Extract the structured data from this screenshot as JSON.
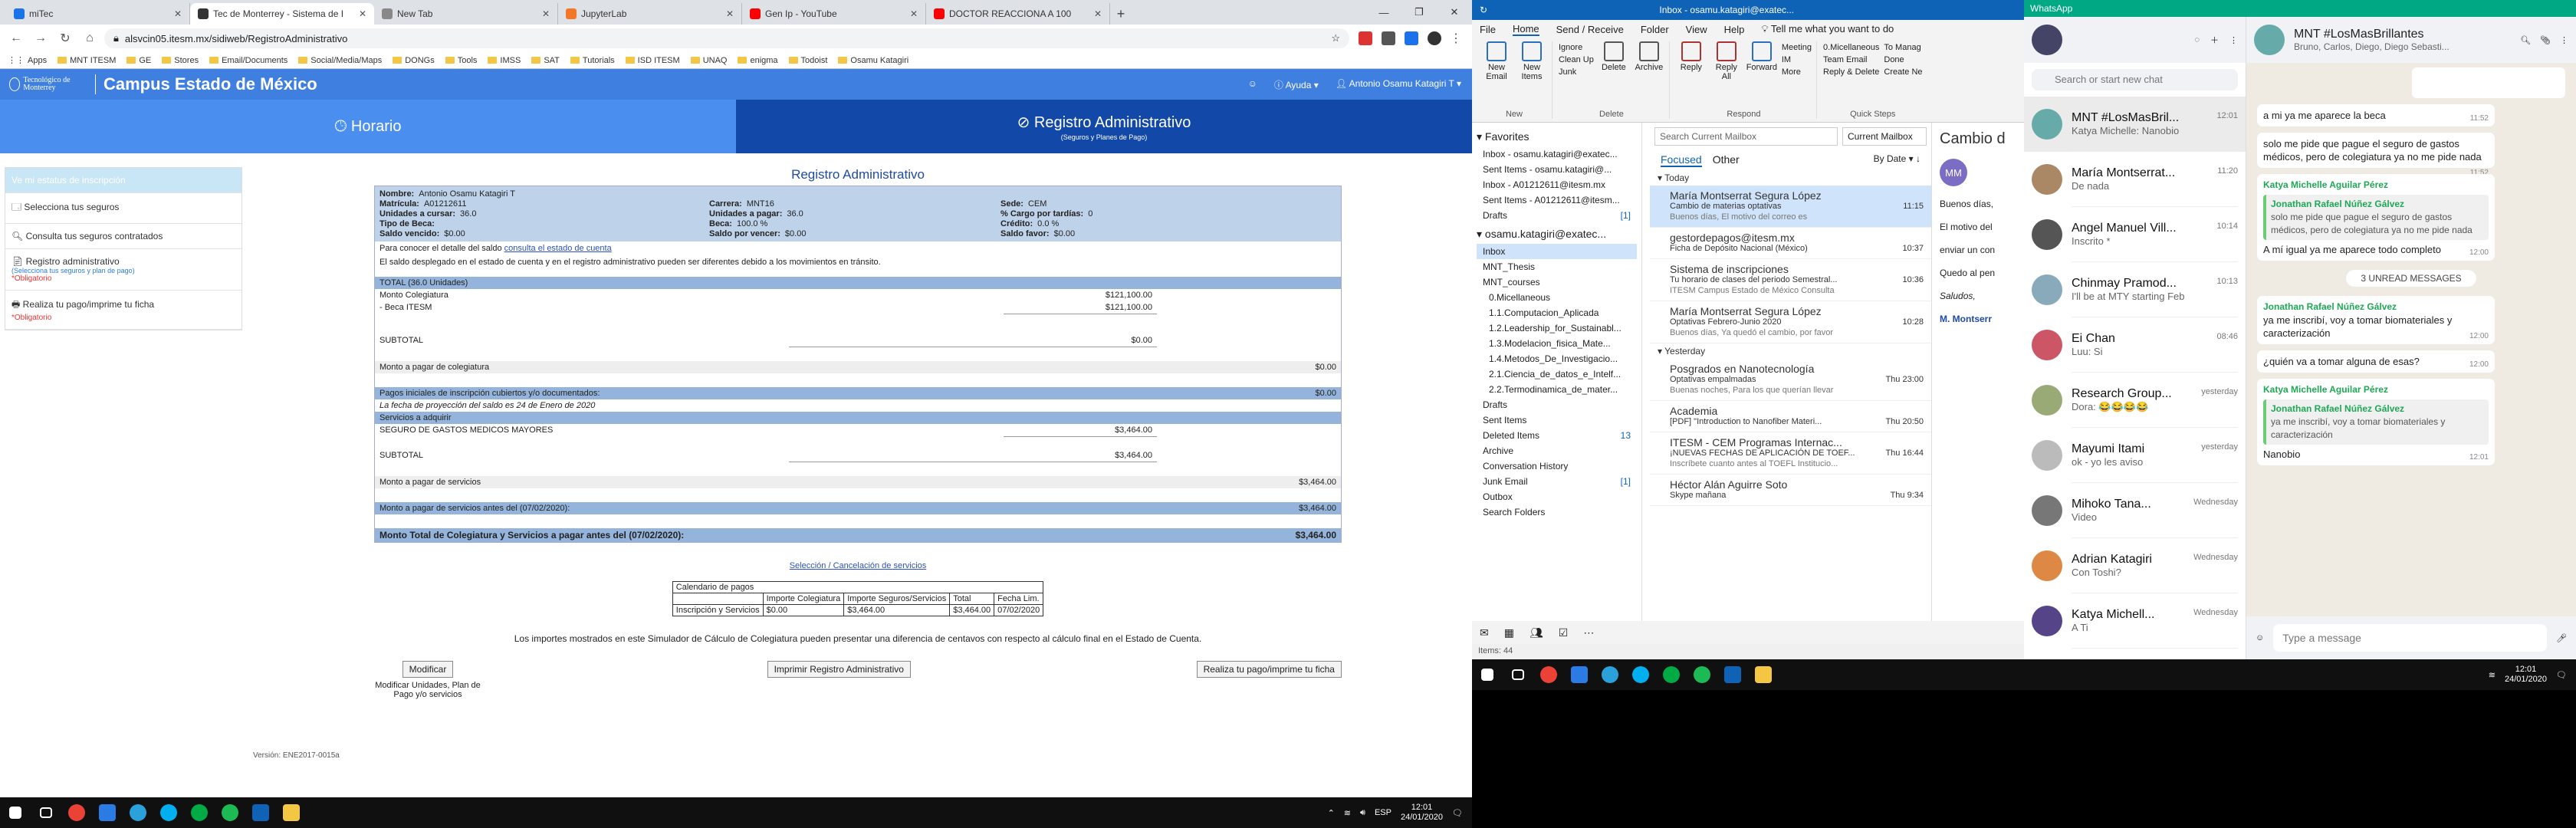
{
  "chrome": {
    "tabs": [
      {
        "title": "miTec",
        "color": "#1a73e8",
        "active": false
      },
      {
        "title": "Tec de Monterrey - Sistema de I",
        "color": "#333",
        "active": true
      },
      {
        "title": "New Tab",
        "color": "#888",
        "active": false
      },
      {
        "title": "JupyterLab",
        "color": "#f37726",
        "active": false
      },
      {
        "title": "Gen Ip - YouTube",
        "color": "#ff0000",
        "active": false
      },
      {
        "title": "DOCTOR REACCIONA A 100",
        "color": "#ff0000",
        "active": false
      }
    ],
    "url": "alsvcin05.itesm.mx/sidiweb/RegistroAdministrativo",
    "bookmarks": [
      "Apps",
      "MNT ITESM",
      "GE",
      "Stores",
      "Email/Documents",
      "Social/Media/Maps",
      "DONGs",
      "Tools",
      "IMSS",
      "SAT",
      "Tutorials",
      "ISD ITESM",
      "UNAQ",
      "enigma",
      "Todoist",
      "Osamu Katagiri"
    ]
  },
  "site": {
    "logo": "Tecnológico de Monterrey",
    "campus": "Campus Estado de México",
    "help": "Ayuda",
    "user": "Antonio Osamu Katagiri T",
    "tab_horario": "Horario",
    "tab_registro": "Registro Administrativo",
    "tab_registro_sub": "(Seguros y Planes de Pago)",
    "menu": [
      {
        "label": "Ve mi estatus de inscripción",
        "sub": "",
        "req": ""
      },
      {
        "label": "Selecciona tus seguros",
        "sub": "",
        "req": ""
      },
      {
        "label": "Consulta tus seguros contratados",
        "sub": "",
        "req": ""
      },
      {
        "label": "Registro administrativo",
        "sub": "(Selecciona tus seguros y plan de pago)",
        "req": "*Obligatorio"
      },
      {
        "label": "Realiza tu pago/imprime tu ficha",
        "sub": "",
        "req": "*Obligatorio"
      }
    ],
    "title": "Registro Administrativo",
    "info": [
      [
        "Nombre:",
        "Antonio Osamu Katagiri T"
      ],
      [
        "",
        ""
      ],
      [
        "",
        ""
      ],
      [
        "Matrícula:",
        "A01212611"
      ],
      [
        "Carrera:",
        "MNT16"
      ],
      [
        "Sede:",
        "CEM"
      ],
      [
        "Unidades a cursar:",
        "36.0"
      ],
      [
        "Unidades a pagar:",
        "36.0"
      ],
      [
        "% Cargo por tardías:",
        "0"
      ],
      [
        "Tipo de Beca:",
        ""
      ],
      [
        "Beca:",
        "100.0 %"
      ],
      [
        "Crédito:",
        "0.0 %"
      ],
      [
        "Saldo vencido:",
        "$0.00"
      ],
      [
        "Saldo por vencer:",
        "$0.00"
      ],
      [
        "Saldo favor:",
        "$0.00"
      ]
    ],
    "note1": "Para conocer el detalle del saldo",
    "note1_link": "consulta el estado de cuenta",
    "note2": "El saldo desplegado en el estado de cuenta y en el registro administrativo pueden ser diferentes debido a los movimientos en tránsito.",
    "total_header": "TOTAL (36.0 Unidades)",
    "colegiatura": "Monto Colegiatura",
    "colegiatura_amt": "$121,100.00",
    "beca": "- Beca ITESM",
    "beca_amt": "$121,100.00",
    "subtotal": "SUBTOTAL",
    "subtotal1_amt": "$0.00",
    "pagar_coleg": "Monto a pagar de colegiatura",
    "pagar_coleg_amt": "$0.00",
    "pagos_iniciales": "Pagos iniciales de inscripción cubiertos y/o documentados:",
    "pagos_iniciales_amt": "$0.00",
    "fecha_proy": "La fecha de proyección del saldo es 24 de Enero de 2020",
    "servicios": "Servicios a adquirir",
    "seguro": "SEGURO DE GASTOS MEDICOS MAYORES",
    "seguro_amt": "$3,464.00",
    "subtotal2_amt": "$3,464.00",
    "pagar_serv": "Monto a pagar de servicios",
    "pagar_serv_amt": "$3,464.00",
    "pagar_serv_antes": "Monto a pagar de servicios antes del (07/02/2020):",
    "pagar_serv_antes_amt": "$3,464.00",
    "total_antes": "Monto Total de Colegiatura y Servicios a pagar antes del (07/02/2020):",
    "total_antes_amt": "$3,464.00",
    "seleccion_link": "Selección / Cancelación de servicios",
    "cal_title": "Calendario de pagos",
    "cal_headers": [
      "",
      "Importe Colegiatura",
      "Importe Seguros/Servicios",
      "Total",
      "Fecha Lim."
    ],
    "cal_row": [
      "Inscripción y Servicios",
      "$0.00",
      "$3,464.00",
      "$3,464.00",
      "07/02/2020"
    ],
    "disclaimer": "Los importes mostrados en este Simulador de Cálculo de Colegiatura pueden presentar una diferencia de centavos con respecto al cálculo final en el Estado de Cuenta.",
    "btn_modificar": "Modificar",
    "btn_modificar_sub": "Modificar Unidades, Plan de Pago y/o servicios",
    "btn_imprimir": "Imprimir Registro Administrativo",
    "btn_pago": "Realiza tu pago/imprime tu ficha",
    "version": "Versión: ENE2017-0015a"
  },
  "taskbar_left": {
    "lang": "ESP",
    "time": "12:01",
    "date": "24/01/2020"
  },
  "outlook": {
    "title": "Inbox - osamu.katagiri@exatec...",
    "menu": [
      "File",
      "Home",
      "Send / Receive",
      "Folder",
      "View",
      "Help",
      "Tell me what you want to do"
    ],
    "ribbon": {
      "new_email": "New Email",
      "new_items": "New Items",
      "new": "New",
      "ignore": "Ignore",
      "clean": "Clean Up",
      "junk": "Junk",
      "delete": "Delete",
      "archive": "Archive",
      "delete_group": "Delete",
      "reply": "Reply",
      "reply_all": "Reply All",
      "forward": "Forward",
      "meeting": "Meeting",
      "im": "IM",
      "more": "More",
      "respond": "Respond",
      "qs1": "0.Micellaneous",
      "qs2": "Team Email",
      "qs3": "Reply & Delete",
      "qs4": "To Manag",
      "qs5": "Done",
      "qs6": "Create Ne",
      "quick": "Quick Steps"
    },
    "favorites": "Favorites",
    "fav": [
      {
        "n": "Inbox - osamu.katagiri@exatec...",
        "c": ""
      },
      {
        "n": "Sent Items - osamu.katagiri@...",
        "c": ""
      },
      {
        "n": "Inbox - A01212611@itesm.mx",
        "c": ""
      },
      {
        "n": "Sent Items - A01212611@itesm...",
        "c": ""
      },
      {
        "n": "Drafts",
        "c": "[1]"
      }
    ],
    "account": "osamu.katagiri@exatec...",
    "folders": [
      {
        "n": "Inbox",
        "c": "",
        "sel": true
      },
      {
        "n": "MNT_Thesis",
        "c": ""
      },
      {
        "n": "MNT_courses",
        "c": ""
      },
      {
        "n": "0.Micellaneous",
        "c": ""
      },
      {
        "n": "1.1.Computacion_Aplicada",
        "c": ""
      },
      {
        "n": "1.2.Leadership_for_Sustainabl...",
        "c": ""
      },
      {
        "n": "1.3.Modelacion_fisica_Mate...",
        "c": ""
      },
      {
        "n": "1.4.Metodos_De_Investigacio...",
        "c": ""
      },
      {
        "n": "2.1.Ciencia_de_datos_e_Intelf...",
        "c": ""
      },
      {
        "n": "2.2.Termodinamica_de_mater...",
        "c": ""
      },
      {
        "n": "Drafts",
        "c": ""
      },
      {
        "n": "Sent Items",
        "c": ""
      },
      {
        "n": "Deleted Items",
        "c": "13"
      },
      {
        "n": "Archive",
        "c": ""
      },
      {
        "n": "Conversation History",
        "c": ""
      },
      {
        "n": "Junk Email",
        "c": "[1]"
      },
      {
        "n": "Outbox",
        "c": ""
      },
      {
        "n": "Search Folders",
        "c": ""
      }
    ],
    "search": "Search Current Mailbox",
    "scope": "Current Mailbox",
    "focused": "Focused",
    "other": "Other",
    "bydate": "By Date",
    "today": "Today",
    "yesterday": "Yesterday",
    "mails_today": [
      {
        "from": "María Montserrat Segura López",
        "subj": "Cambio de materias optativas",
        "time": "11:15",
        "prev": "Buenos días,  El motivo del correo es",
        "sel": true
      },
      {
        "from": "gestordepagos@itesm.mx",
        "subj": "Ficha de Depósito Nacional (México)",
        "time": "10:37",
        "prev": "",
        "sel": false
      },
      {
        "from": "Sistema de inscripciones",
        "subj": "Tu horario de clases del periodo Semestral...",
        "time": "10:36",
        "prev": "ITESM Campus Estado de México  Consulta",
        "sel": false
      },
      {
        "from": "María Montserrat Segura López",
        "subj": "Optativas Febrero-Junio 2020",
        "time": "10:28",
        "prev": "Buenos días,  Ya quedó el cambio, por favor",
        "sel": false
      }
    ],
    "mails_yesterday": [
      {
        "from": "Posgrados en Nanotecnología",
        "subj": "Optativas empalmadas",
        "time": "Thu 23:00",
        "prev": "Buenas noches,  Para los que querían llevar"
      },
      {
        "from": "Academia",
        "subj": "[PDF] \"Introduction to Nanofiber Materi...",
        "time": "Thu 20:50",
        "prev": ""
      },
      {
        "from": "ITESM - CEM Programas Internac...",
        "subj": "¡NUEVAS FECHAS DE APLICACIÓN DE TOEF...",
        "time": "Thu 16:44",
        "prev": "Inscríbete cuanto antes al TOEFL Institucio..."
      },
      {
        "from": "Héctor Alán Aguirre Soto",
        "subj": "Skype mañana",
        "time": "Thu 9:34",
        "prev": ""
      }
    ],
    "reading_title": "Cambio d",
    "reading_greet": "Buenos días,",
    "reading_l1": "El motivo del",
    "reading_l2": "enviar un con",
    "reading_l3": "Quedo al pen",
    "reading_sal": "Saludos,",
    "reading_sig": "M. Montserr",
    "items": "Items: 44"
  },
  "whatsapp": {
    "title": "WhatsApp",
    "search": "Search or start new chat",
    "chats": [
      {
        "n": "MNT #LosMasBril...",
        "m": "Katya Michelle: Nanobio",
        "t": "12:01",
        "c": "#6aa",
        "sel": true
      },
      {
        "n": "María Montserrat...",
        "m": "De nada",
        "t": "11:20",
        "c": "#a86"
      },
      {
        "n": "Angel Manuel Vill...",
        "m": "Inscrito *",
        "t": "10:14",
        "c": "#555"
      },
      {
        "n": "Chinmay Pramod...",
        "m": "I'll be at MTY starting Feb",
        "t": "10:13",
        "c": "#8ab"
      },
      {
        "n": "Ei Chan",
        "m": "Luu: Si",
        "t": "08:46",
        "c": "#c56"
      },
      {
        "n": "Research Group...",
        "m": "Dora: 😂😂😂😂",
        "t": "yesterday",
        "c": "#9a7"
      },
      {
        "n": "Mayumi Itami",
        "m": "ok - yo les aviso",
        "t": "yesterday",
        "c": "#bbb"
      },
      {
        "n": "Mihoko Tana...",
        "m": "Video",
        "t": "Wednesday",
        "c": "#777"
      },
      {
        "n": "Adrian Katagiri",
        "m": "Con Toshi?",
        "t": "Wednesday",
        "c": "#d84"
      },
      {
        "n": "Katya Michell...",
        "m": "A Ti",
        "t": "Wednesday",
        "c": "#548"
      }
    ],
    "group": "MNT #LosMasBrillantes",
    "members": "Bruno, Carlos, Diego, Diego Sebasti...",
    "msgs": [
      {
        "dir": "in",
        "au": "",
        "q_au": "",
        "q": "",
        "text": "a mi ya me aparece la beca",
        "t": "11:52"
      },
      {
        "dir": "in",
        "au": "",
        "q_au": "",
        "q": "",
        "text": "solo me pide que pague el seguro de gastos médicos, pero de colegiatura ya no me pide nada",
        "t": "11:52"
      },
      {
        "dir": "in",
        "au": "Katya Michelle Aguilar Pérez",
        "q_au": "Jonathan Rafael Núñez Gálvez",
        "q": "solo me pide que pague el seguro de gastos médicos, pero de colegiatura ya no me pide nada",
        "text": "A mí igual ya me aparece todo completo",
        "t": "12:00"
      }
    ],
    "unread": "3 UNREAD MESSAGES",
    "msgs2": [
      {
        "dir": "in",
        "au": "Jonathan Rafael Núñez Gálvez",
        "text": "ya me inscribí, voy a tomar biomateriales y caracterización",
        "t": "12:00"
      },
      {
        "dir": "in",
        "au": "",
        "text": "¿quién va a tomar alguna de esas?",
        "t": "12:00"
      },
      {
        "dir": "in",
        "au": "Katya Michelle Aguilar Pérez",
        "q_au": "Jonathan Rafael Núñez Gálvez",
        "q": "ya me inscribí, voy a tomar biomateriales y caracterización",
        "text": "Nanobio",
        "t": "12:01"
      }
    ],
    "compose": "Type a message"
  },
  "taskbar_right": {
    "time": "12:01",
    "date": "24/01/2020"
  }
}
